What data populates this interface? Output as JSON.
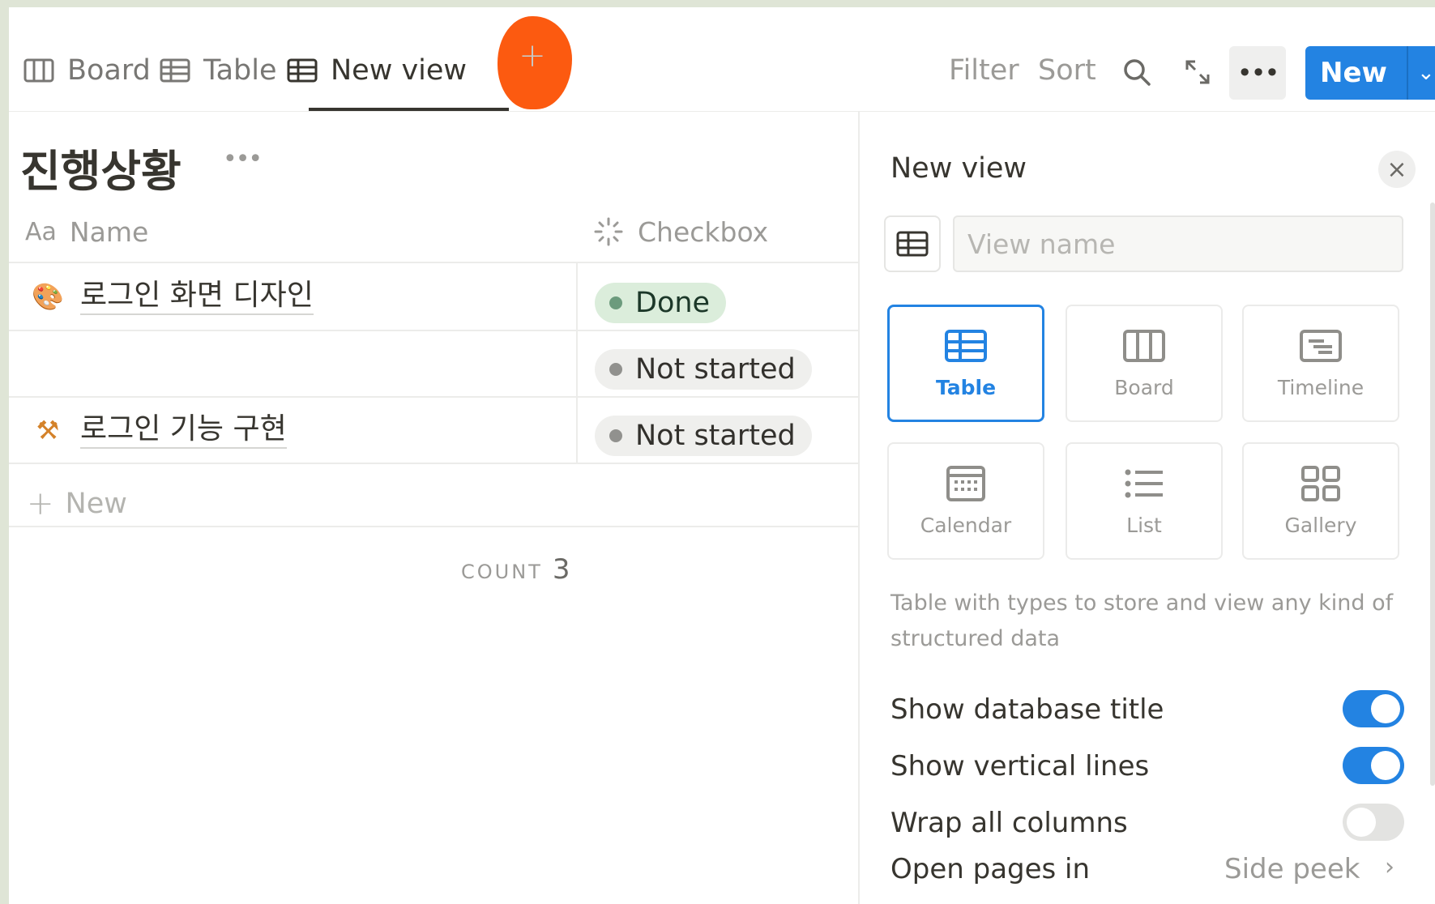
{
  "tabs": [
    {
      "label": "Board",
      "icon": "board-icon"
    },
    {
      "label": "Table",
      "icon": "table-icon"
    },
    {
      "label": "New view",
      "icon": "table-icon",
      "active": true
    }
  ],
  "add_view": {
    "label": "+"
  },
  "toolbar": {
    "filter_label": "Filter",
    "sort_label": "Sort",
    "more_label": "•••",
    "new_label": "New",
    "new_caret": "⌄"
  },
  "database": {
    "title": "진행상황",
    "title_more": "•••",
    "columns": {
      "name_prefix": "Aa",
      "name": "Name",
      "status": "Checkbox"
    },
    "rows": [
      {
        "icon": "palette-icon",
        "emoji": "🎨",
        "name": "로그인 화면 디자인",
        "status": "Done"
      },
      {
        "icon": "",
        "emoji": "",
        "name": "",
        "status": "Not started"
      },
      {
        "icon": "hammer-pick-icon",
        "emoji": "⚒",
        "name": "로그인 기능 구현",
        "status": "Not started"
      }
    ],
    "add_row_label": "New",
    "count_label": "COUNT",
    "count_value": "3"
  },
  "panel": {
    "title": "New view",
    "close": "×",
    "view_name_placeholder": "View name",
    "view_types": [
      {
        "label": "Table",
        "icon": "table-icon",
        "selected": true
      },
      {
        "label": "Board",
        "icon": "board-icon",
        "selected": false
      },
      {
        "label": "Timeline",
        "icon": "timeline-icon",
        "selected": false
      },
      {
        "label": "Calendar",
        "icon": "calendar-icon",
        "selected": false
      },
      {
        "label": "List",
        "icon": "list-icon",
        "selected": false
      },
      {
        "label": "Gallery",
        "icon": "gallery-icon",
        "selected": false
      }
    ],
    "description": "Table with types to store and view any kind of structured data",
    "options": [
      {
        "label": "Show database title",
        "on": true
      },
      {
        "label": "Show vertical lines",
        "on": true
      },
      {
        "label": "Wrap all columns",
        "on": false
      }
    ],
    "open_pages_label": "Open pages in",
    "open_pages_value": "Side peek",
    "open_pages_chevron": "›"
  },
  "colors": {
    "accent": "#2383e2",
    "highlight": "#fc5a10",
    "done_bg": "#dbeddb",
    "not_started_bg": "#efefed"
  }
}
